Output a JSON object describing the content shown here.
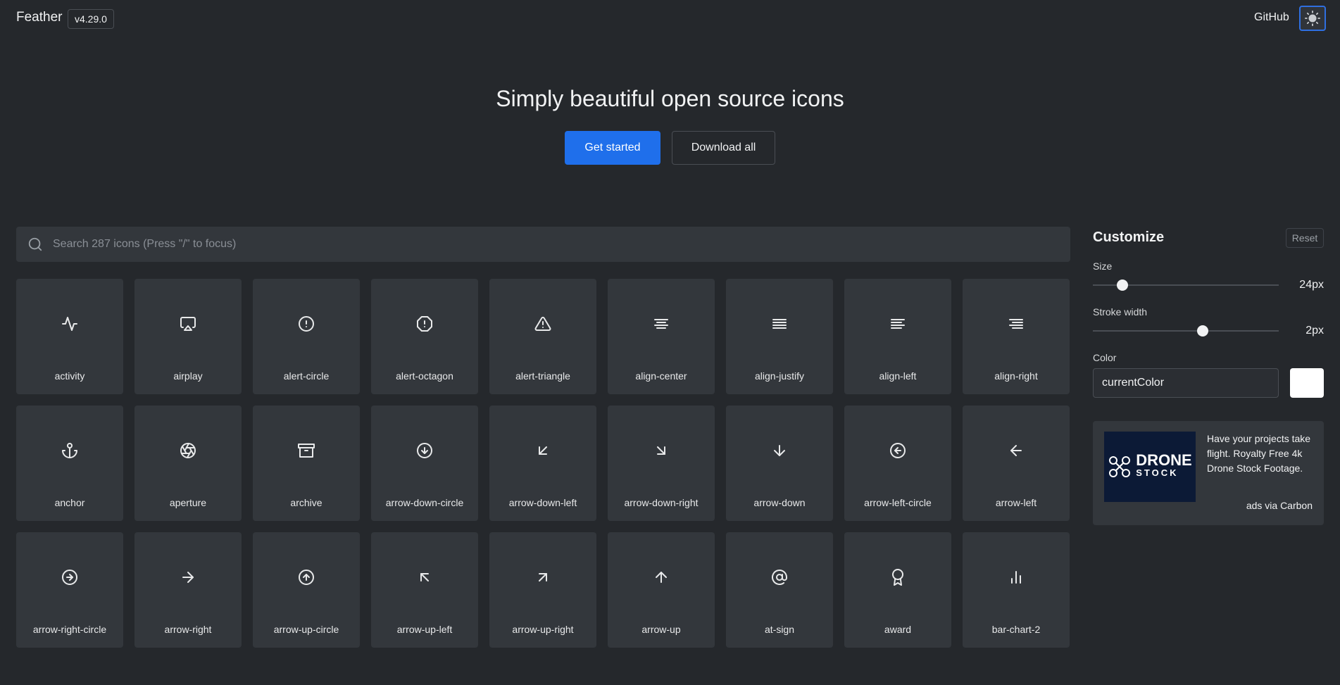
{
  "header": {
    "brand": "Feather",
    "version": "v4.29.0",
    "github_label": "GitHub"
  },
  "hero": {
    "title": "Simply beautiful open source icons",
    "primary_button": "Get started",
    "secondary_button": "Download all"
  },
  "search": {
    "placeholder": "Search 287 icons (Press \"/\" to focus)"
  },
  "icons": [
    {
      "name": "activity",
      "icon": "activity-icon"
    },
    {
      "name": "airplay",
      "icon": "airplay-icon"
    },
    {
      "name": "alert-circle",
      "icon": "alert-circle-icon"
    },
    {
      "name": "alert-octagon",
      "icon": "alert-octagon-icon"
    },
    {
      "name": "alert-triangle",
      "icon": "alert-triangle-icon"
    },
    {
      "name": "align-center",
      "icon": "align-center-icon"
    },
    {
      "name": "align-justify",
      "icon": "align-justify-icon"
    },
    {
      "name": "align-left",
      "icon": "align-left-icon"
    },
    {
      "name": "align-right",
      "icon": "align-right-icon"
    },
    {
      "name": "anchor",
      "icon": "anchor-icon"
    },
    {
      "name": "aperture",
      "icon": "aperture-icon"
    },
    {
      "name": "archive",
      "icon": "archive-icon"
    },
    {
      "name": "arrow-down-circle",
      "icon": "arrow-down-circle-icon"
    },
    {
      "name": "arrow-down-left",
      "icon": "arrow-down-left-icon"
    },
    {
      "name": "arrow-down-right",
      "icon": "arrow-down-right-icon"
    },
    {
      "name": "arrow-down",
      "icon": "arrow-down-icon"
    },
    {
      "name": "arrow-left-circle",
      "icon": "arrow-left-circle-icon"
    },
    {
      "name": "arrow-left",
      "icon": "arrow-left-icon"
    },
    {
      "name": "arrow-right-circle",
      "icon": "arrow-right-circle-icon"
    },
    {
      "name": "arrow-right",
      "icon": "arrow-right-icon"
    },
    {
      "name": "arrow-up-circle",
      "icon": "arrow-up-circle-icon"
    },
    {
      "name": "arrow-up-left",
      "icon": "arrow-up-left-icon"
    },
    {
      "name": "arrow-up-right",
      "icon": "arrow-up-right-icon"
    },
    {
      "name": "arrow-up",
      "icon": "arrow-up-icon"
    },
    {
      "name": "at-sign",
      "icon": "at-sign-icon"
    },
    {
      "name": "award",
      "icon": "award-icon"
    },
    {
      "name": "bar-chart-2",
      "icon": "bar-chart-2-icon"
    }
  ],
  "customize": {
    "title": "Customize",
    "reset_label": "Reset",
    "size_label": "Size",
    "size_value": "24px",
    "size_fraction": 0.16,
    "stroke_label": "Stroke width",
    "stroke_value": "2px",
    "stroke_fraction": 0.59,
    "color_label": "Color",
    "color_value": "currentColor",
    "swatch_color": "#ffffff"
  },
  "ad": {
    "image_title": "DRONE",
    "image_subtitle": "STOCK",
    "text": "Have your projects take flight. Royalty Free 4k Drone Stock Footage.",
    "via": "ads via Carbon"
  },
  "colors": {
    "background": "#25282c",
    "tile": "#33373c",
    "accent": "#1f6feb"
  }
}
